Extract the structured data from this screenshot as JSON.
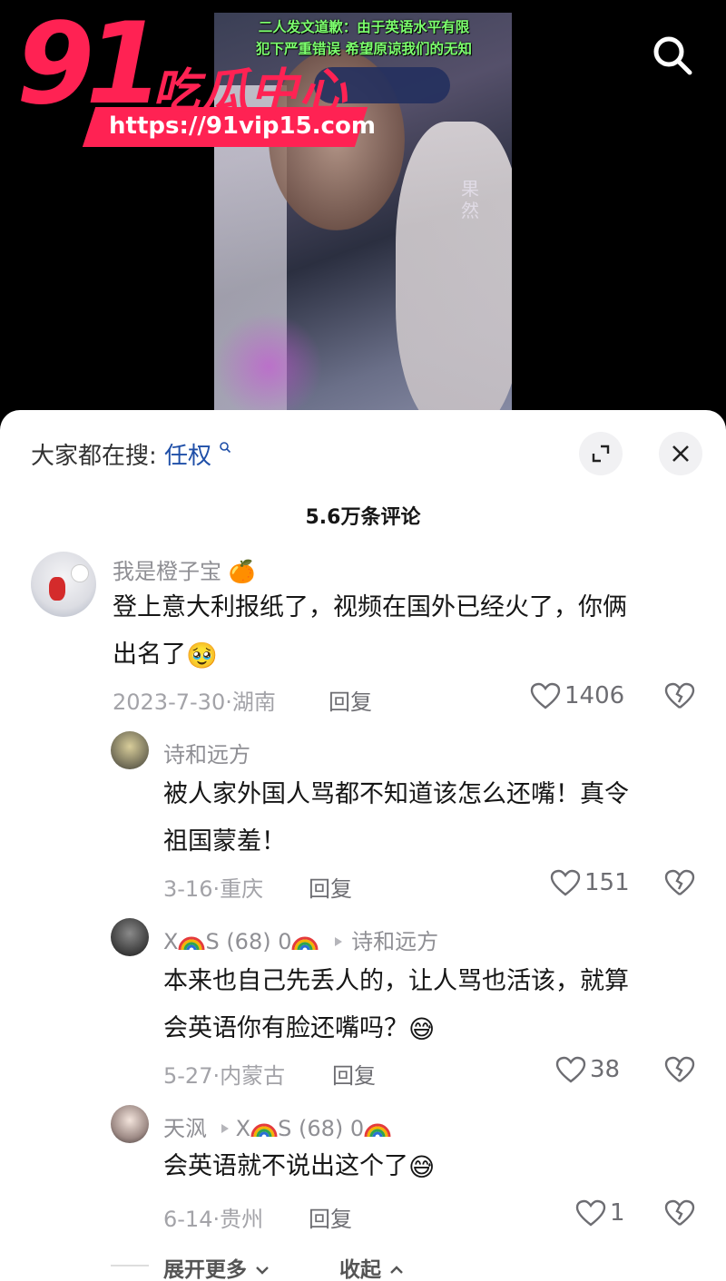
{
  "video": {
    "caption_line1": "二人发文道歉：由于英语水平有限",
    "caption_line2": "犯下严重错误 希望原谅我们的无知",
    "watermark": "果然"
  },
  "logo": {
    "number": "91",
    "name": "吃瓜中心",
    "url": "https://91vip15.com"
  },
  "colors": {
    "brand": "#ff2253",
    "caption": "#7cff6e",
    "keyword": "#1f4fa8"
  },
  "sheet": {
    "search_label": "大家都在搜:",
    "search_keyword": "任权",
    "expand_icon": "expand-icon",
    "close_icon": "close-icon",
    "comment_count": "5.6万条评论"
  },
  "comments": [
    {
      "user": "我是橙子宝",
      "user_emoji": "🍊",
      "text_line1": "登上意大利报纸了，视频在国外已经火了，你俩",
      "text_line2": "出名了",
      "text_emoji": "🥹",
      "date": "2023-7-30",
      "location": "湖南",
      "reply_label": "回复",
      "likes": "1406"
    },
    {
      "user": "诗和远方",
      "text_line1": "被人家外国人骂都不知道该怎么还嘴！真令",
      "text_line2": "祖国蒙羞！",
      "date": "3-16",
      "location": "重庆",
      "reply_label": "回复",
      "likes": "151"
    },
    {
      "user_prefix": "X",
      "user_mid": "S (68) 0",
      "reply_to": "诗和远方",
      "text_line1": "本来也自己先丢人的，让人骂也活该，就算",
      "text_line2": "会英语你有脸还嘴吗？",
      "text_emoji": "😅",
      "date": "5-27",
      "location": "内蒙古",
      "reply_label": "回复",
      "likes": "38"
    },
    {
      "user": "天沨",
      "reply_to_prefix": "X",
      "reply_to_mid": "S (68) 0",
      "text_line1": "会英语就不说出这个了",
      "text_emoji": "😅",
      "date": "6-14",
      "location": "贵州",
      "reply_label": "回复",
      "likes": "1"
    }
  ],
  "footer": {
    "expand_more": "展开更多",
    "collapse": "收起"
  }
}
